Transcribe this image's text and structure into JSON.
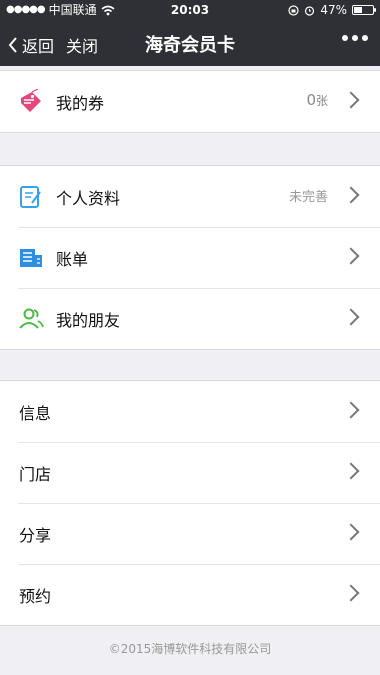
{
  "status": {
    "carrier": "中国联通",
    "time": "20:03",
    "battery": "47%",
    "battery_level": 0.47,
    "signal_icon": "signal-dots-icon",
    "wifi_icon": "wifi-icon",
    "lock_icon": "rotation-lock-icon",
    "alarm_icon": "alarm-icon",
    "battery_icon": "battery-icon"
  },
  "nav": {
    "back_label": "返回",
    "close_label": "关闭",
    "title": "海奇会员卡",
    "more_icon": "more-dots-icon"
  },
  "section1": {
    "items": [
      {
        "label": "我的券",
        "value": "0",
        "value_unit": "张",
        "icon": "coupon-tag-icon"
      }
    ]
  },
  "section2": {
    "items": [
      {
        "label": "个人资料",
        "value": "未完善",
        "icon": "profile-notepad-icon"
      },
      {
        "label": "账单",
        "value": "",
        "icon": "bill-building-icon"
      },
      {
        "label": "我的朋友",
        "value": "",
        "icon": "friends-icon"
      }
    ]
  },
  "section3": {
    "items": [
      {
        "label": "信息"
      },
      {
        "label": "门店"
      },
      {
        "label": "分享"
      },
      {
        "label": "预约"
      }
    ]
  },
  "footer": {
    "text": "©2015海博软件科技有限公司"
  },
  "colors": {
    "header_bg": "#2f3035",
    "page_bg": "#efeff4",
    "coupon_icon": "#e8457a",
    "profile_icon": "#3aa0e8",
    "bill_icon": "#2e8fe0",
    "friends_icon": "#4cb848"
  }
}
